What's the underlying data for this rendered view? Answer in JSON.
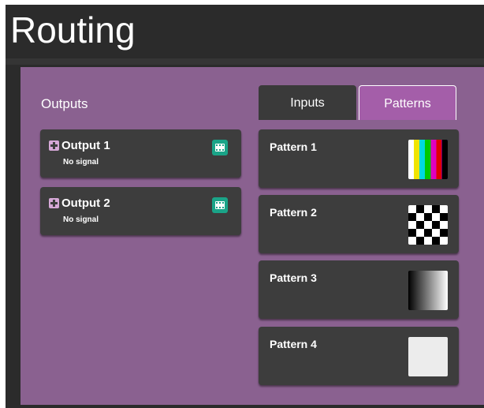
{
  "page_title": "Routing",
  "outputs": {
    "heading": "Outputs",
    "items": [
      {
        "name": "Output 1",
        "status": "No signal"
      },
      {
        "name": "Output 2",
        "status": "No signal"
      }
    ]
  },
  "tabs": [
    {
      "label": "Inputs",
      "active": false
    },
    {
      "label": "Patterns",
      "active": true
    }
  ],
  "patterns": [
    {
      "name": "Pattern 1",
      "thumbnail": "color-bars"
    },
    {
      "name": "Pattern 2",
      "thumbnail": "checkerboard"
    },
    {
      "name": "Pattern 3",
      "thumbnail": "black-white-gradient"
    },
    {
      "name": "Pattern 4",
      "thumbnail": "solid-white"
    }
  ],
  "colors": {
    "panel_background": "#8a6190",
    "active_tab": "#a45ea9",
    "card_background": "#3d3d3d",
    "signal_icon": "#1aa488"
  }
}
